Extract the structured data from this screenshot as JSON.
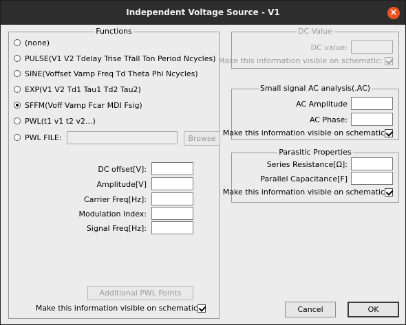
{
  "window": {
    "title": "Independent Voltage Source - V1",
    "close_glyph": "×"
  },
  "functions": {
    "legend": "Functions",
    "options": [
      {
        "label": "(none)",
        "checked": false
      },
      {
        "label": "PULSE(V1 V2 Tdelay Trise Tfall Ton Period Ncycles)",
        "checked": false
      },
      {
        "label": "SINE(Voffset Vamp Freq Td Theta Phi Ncycles)",
        "checked": false
      },
      {
        "label": "EXP(V1 V2 Td1 Tau1 Td2 Tau2)",
        "checked": false
      },
      {
        "label": "SFFM(Voff Vamp Fcar MDI Fsig)",
        "checked": true
      },
      {
        "label": "PWL(t1 v1 t2 v2...)",
        "checked": false
      },
      {
        "label": "PWL FILE:",
        "checked": false
      }
    ],
    "pwl_file_value": "",
    "browse_label": "Browse",
    "params": [
      {
        "label": "DC offset[V]:",
        "value": ""
      },
      {
        "label": "Amplitude[V]",
        "value": ""
      },
      {
        "label": "Carrier Freq[Hz]:",
        "value": ""
      },
      {
        "label": "Modulation Index:",
        "value": ""
      },
      {
        "label": "Signal Freq[Hz]:",
        "value": ""
      }
    ],
    "additional_pwl_label": "Additional PWL Points",
    "visible_label": "Make this information visible on schematic",
    "visible_checked": true
  },
  "dc_value": {
    "legend": "DC Value",
    "field_label": "DC value:",
    "value": "",
    "visible_label": "Make this information visible on schematic:",
    "visible_checked": true
  },
  "small_signal": {
    "legend": "Small signal AC analysis(.AC)",
    "amplitude_label": "AC Amplitude",
    "amplitude_value": "",
    "phase_label": "AC Phase:",
    "phase_value": "",
    "visible_label": "Make this information visible on schematic",
    "visible_checked": true
  },
  "parasitic": {
    "legend": "Parasitic Properties",
    "series_label": "Series Resistance[Ω]:",
    "series_value": "",
    "parallel_label": "Parallel Capacitance[F]",
    "parallel_value": "",
    "visible_label": "Make this information visible on schematic",
    "visible_checked": true
  },
  "buttons": {
    "cancel": "Cancel",
    "ok": "OK"
  }
}
